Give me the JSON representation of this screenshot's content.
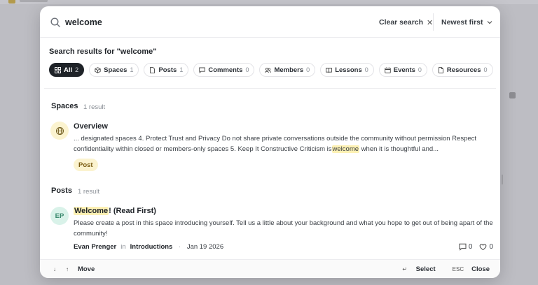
{
  "search": {
    "value": "welcome",
    "clear_label": "Clear search",
    "sort_label": "Newest first"
  },
  "results_heading": "Search results for \"welcome\"",
  "filters": [
    {
      "label": "All",
      "count": "2"
    },
    {
      "label": "Spaces",
      "count": "1"
    },
    {
      "label": "Posts",
      "count": "1"
    },
    {
      "label": "Comments",
      "count": "0"
    },
    {
      "label": "Members",
      "count": "0"
    },
    {
      "label": "Lessons",
      "count": "0"
    },
    {
      "label": "Events",
      "count": "0"
    },
    {
      "label": "Resources",
      "count": "0"
    }
  ],
  "sections": {
    "spaces": {
      "title": "Spaces",
      "count": "1 result",
      "result": {
        "title": "Overview",
        "snippet_before": "... designated spaces 4. Protect Trust and Privacy Do not share private conversations outside the community without permission Respect confidentiality within closed or members-only spaces 5. Keep It Constructive Criticism is",
        "snippet_highlight": "welcome",
        "snippet_after": " when it is thoughtful and...",
        "tag": "Post"
      }
    },
    "posts": {
      "title": "Posts",
      "count": "1 result",
      "result": {
        "avatar_initials": "EP",
        "title_highlight": "Welcome",
        "title_rest": "! (Read First)",
        "snippet": "Please create a post in this space introducing yourself. Tell us a little about your background and what you hope to get out of being apart of the community!",
        "author": "Evan Prenger",
        "in_label": "in",
        "space": "Introductions",
        "date": "Jan 19 2026",
        "comments": "0",
        "likes": "0"
      }
    }
  },
  "footer": {
    "move_label": "Move",
    "select_label": "Select",
    "esc_key": "ESC",
    "close_label": "Close"
  },
  "colors": {
    "highlight": "#fdf1b4",
    "active_pill": "#1f2328",
    "space_icon_bg": "#fbf3cf",
    "avatar_bg": "#d9f2e9"
  },
  "icons": {
    "search": "search-icon",
    "clear": "close-icon",
    "sort": "chevron-down-icon",
    "space": "globe-icon",
    "comment": "comment-icon",
    "like": "heart-icon"
  }
}
